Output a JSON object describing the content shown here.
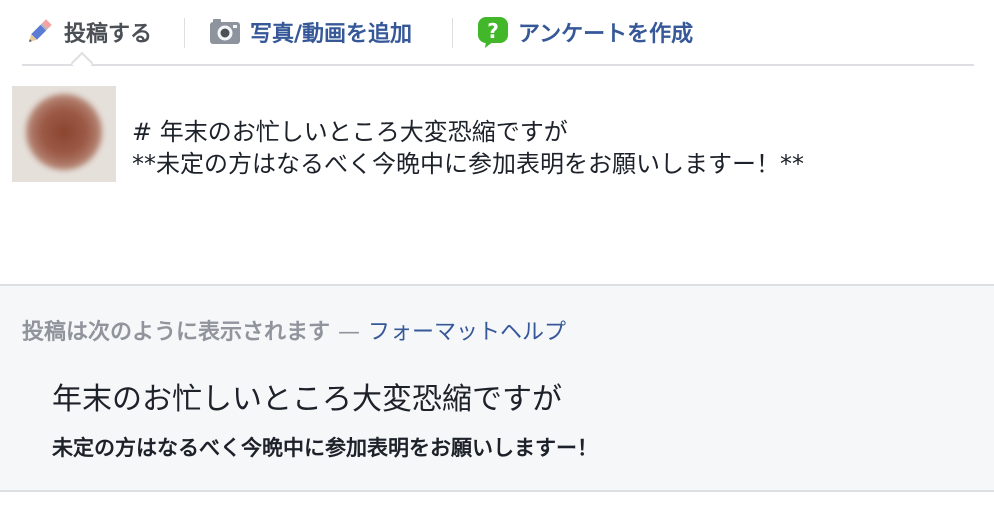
{
  "tabs": {
    "post": {
      "label": "投稿する",
      "icon": "pencil-icon"
    },
    "photo": {
      "label": "写真/動画を追加",
      "icon": "camera-icon"
    },
    "poll": {
      "label": "アンケートを作成",
      "icon": "question-bubble-icon"
    }
  },
  "composer": {
    "avatar": "blurred-profile-photo",
    "lines": [
      "# 年末のお忙しいところ大変恐縮ですが",
      "**未定の方はなるべく今晩中に参加表明をお願いしますー！**"
    ]
  },
  "preview": {
    "label": "投稿は次のように表示されます",
    "separator": "—",
    "help_link": "フォーマットヘルプ",
    "heading": "年末のお忙しいところ大変恐縮ですが",
    "bold_text": "未定の方はなるべく今晩中に参加表明をお願いしますー！"
  },
  "colors": {
    "link": "#365899",
    "muted": "#90949c",
    "text": "#1d2129",
    "border": "#dddfe2",
    "preview_bg": "#f6f7f9",
    "poll_icon": "#42b72a"
  }
}
